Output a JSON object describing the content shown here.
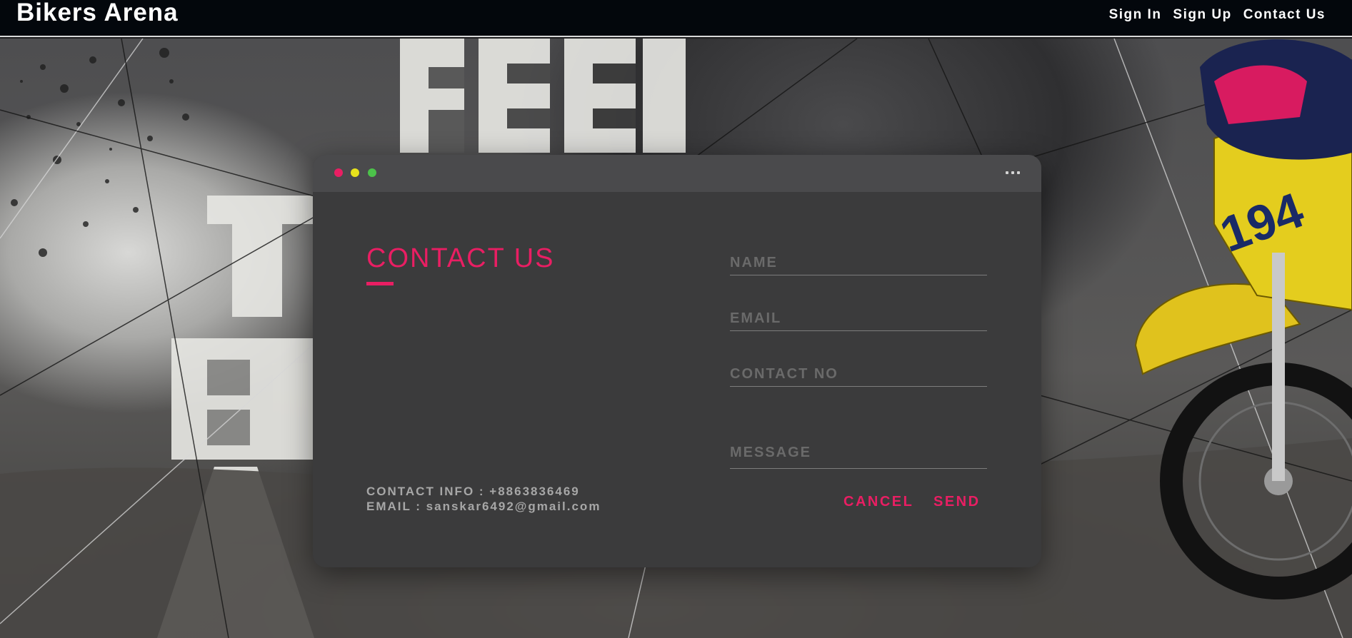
{
  "header": {
    "brand": "Bikers Arena",
    "nav": [
      {
        "label": "Sign In"
      },
      {
        "label": "Sign Up"
      },
      {
        "label": "Contact Us"
      }
    ]
  },
  "hero": {
    "poster_text": "FEEL THE BUZZ"
  },
  "card": {
    "title": "CONTACT US",
    "fields": {
      "name": {
        "placeholder": "NAME",
        "value": ""
      },
      "email": {
        "placeholder": "EMAIL",
        "value": ""
      },
      "contact": {
        "placeholder": "CONTACT NO",
        "value": ""
      },
      "message": {
        "placeholder": "MESSAGE",
        "value": ""
      }
    },
    "info": {
      "contact": "CONTACT INFO : +8863836469",
      "email": "EMAIL : sanskar6492@gmail.com"
    },
    "buttons": {
      "cancel": "CANCEL",
      "send": "SEND"
    }
  },
  "colors": {
    "accent": "#e91e63",
    "card": "#3b3b3c",
    "card_header": "#4a4a4c",
    "topbar": "#03070c",
    "dot_red": "#e91e63",
    "dot_yellow": "#e8e21c",
    "dot_green": "#4cc24a"
  },
  "icons": {
    "more": "more-horizontal-icon",
    "window_controls": [
      "close-dot-icon",
      "minimize-dot-icon",
      "maximize-dot-icon"
    ]
  }
}
